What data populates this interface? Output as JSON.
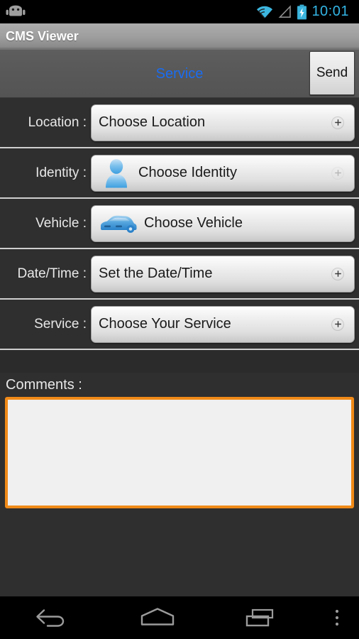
{
  "status_bar": {
    "android_icon": "android-head-icon",
    "wifi_icon": "wifi-icon",
    "signal_icon": "signal-triangle-icon",
    "battery_icon": "battery-charging-icon",
    "time": "10:01",
    "accent_color": "#33b5e5"
  },
  "title_bar": {
    "app_title": "CMS Viewer"
  },
  "action_bar": {
    "tab_label": "Service",
    "tab_color": "#1a6cf0",
    "send_label": "Send"
  },
  "form": {
    "rows": [
      {
        "label": "Location :",
        "value": "Choose Location",
        "icon": "none",
        "badge": "plus-icon",
        "badge_state": "visible"
      },
      {
        "label": "Identity :",
        "value": "Choose Identity",
        "icon": "person-icon",
        "badge": "plus-icon",
        "badge_state": "faint"
      },
      {
        "label": "Vehicle :",
        "value": "Choose Vehicle",
        "icon": "car-icon",
        "badge": "none",
        "badge_state": "hidden"
      },
      {
        "label": "Date/Time :",
        "value": "Set the Date/Time",
        "icon": "none",
        "badge": "plus-icon",
        "badge_state": "visible"
      },
      {
        "label": "Service :",
        "value": "Choose Your Service",
        "icon": "none",
        "badge": "plus-icon",
        "badge_state": "visible"
      }
    ]
  },
  "comments": {
    "label": "Comments :",
    "value": "",
    "placeholder": "",
    "focus_border_color": "#f08a18"
  },
  "nav_bar": {
    "back_icon": "back-arrow-icon",
    "home_icon": "home-pentagon-icon",
    "recents_icon": "recent-apps-icon",
    "overflow_icon": "overflow-menu-icon"
  }
}
